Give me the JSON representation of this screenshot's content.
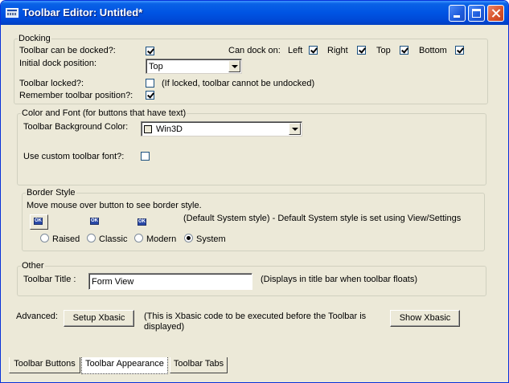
{
  "window": {
    "title": "Toolbar Editor: Untitled*"
  },
  "docking": {
    "group_label": "Docking",
    "can_be_docked_label": "Toolbar can be docked?:",
    "can_be_docked": true,
    "can_dock_on_label": "Can dock on:",
    "dock_left_label": "Left",
    "dock_left": true,
    "dock_right_label": "Right",
    "dock_right": true,
    "dock_top_label": "Top",
    "dock_top": true,
    "dock_bottom_label": "Bottom",
    "dock_bottom": true,
    "initial_position_label": "Initial dock position:",
    "initial_position_value": "Top",
    "locked_label": "Toolbar locked?:",
    "locked": false,
    "locked_hint": "(If locked, toolbar cannot be undocked)",
    "remember_label": "Remember toolbar position?:",
    "remember": true
  },
  "color_font": {
    "group_label": "Color and Font (for buttons that have text)",
    "bg_color_label": "Toolbar Background Color:",
    "bg_color_value": "Win3D",
    "custom_font_label": "Use custom toolbar font?:",
    "custom_font": false
  },
  "border_style": {
    "group_label": "Border Style",
    "instructions": "Move mouse over button to see border style.",
    "sample_button_text": "OK",
    "default_note": "(Default System style)  - Default System style is set using View/Settings",
    "options": [
      {
        "label": "Raised",
        "selected": false
      },
      {
        "label": "Classic",
        "selected": false
      },
      {
        "label": "Modern",
        "selected": false
      },
      {
        "label": "System",
        "selected": true
      }
    ]
  },
  "other": {
    "group_label": "Other",
    "title_label": "Toolbar Title :",
    "title_value": "Form View",
    "title_hint": "(Displays in title bar when toolbar floats)"
  },
  "advanced": {
    "label": "Advanced:",
    "setup_button": "Setup Xbasic",
    "note": "(This is Xbasic code to be executed before the Toolbar is displayed)",
    "note_line1": "(This is Xbasic code to be executed before the Toolbar is",
    "note_line2": "displayed)",
    "show_button": "Show Xbasic"
  },
  "tabs": [
    {
      "label": "Toolbar Buttons",
      "active": false
    },
    {
      "label": "Toolbar Appearance",
      "active": true
    },
    {
      "label": "Toolbar Tabs",
      "active": false
    }
  ],
  "colors": {
    "titlebar": "#0054e3",
    "face": "#ece9d8"
  }
}
